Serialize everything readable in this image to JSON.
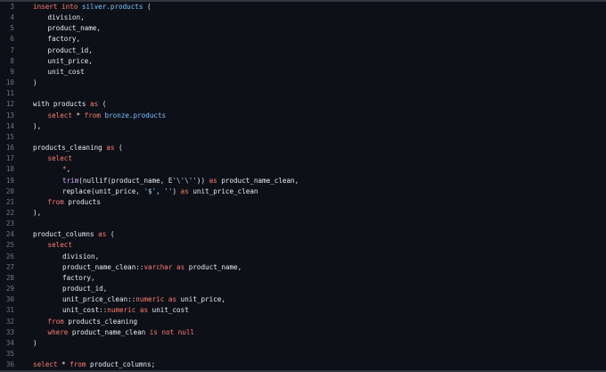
{
  "colors": {
    "background": "#0d1117",
    "line_number": "#6e7681",
    "plain": "#e6edf3",
    "keyword": "#ff7b72",
    "identifier": "#79c0ff",
    "function": "#d2a8ff",
    "string": "#a5d6ff"
  },
  "lines": [
    {
      "n": "3",
      "indent": 0,
      "tokens": [
        {
          "t": "insert into ",
          "c": "kw"
        },
        {
          "t": "silver.products",
          "c": "id"
        },
        {
          "t": " (",
          "c": "pl"
        }
      ]
    },
    {
      "n": "4",
      "indent": 1,
      "tokens": [
        {
          "t": "division,",
          "c": "pl"
        }
      ]
    },
    {
      "n": "5",
      "indent": 1,
      "tokens": [
        {
          "t": "product_name,",
          "c": "pl"
        }
      ]
    },
    {
      "n": "6",
      "indent": 1,
      "tokens": [
        {
          "t": "factory,",
          "c": "pl"
        }
      ]
    },
    {
      "n": "7",
      "indent": 1,
      "tokens": [
        {
          "t": "product_id,",
          "c": "pl"
        }
      ]
    },
    {
      "n": "8",
      "indent": 1,
      "tokens": [
        {
          "t": "unit_price,",
          "c": "pl"
        }
      ]
    },
    {
      "n": "9",
      "indent": 1,
      "tokens": [
        {
          "t": "unit_cost",
          "c": "pl"
        }
      ]
    },
    {
      "n": "10",
      "indent": 0,
      "tokens": [
        {
          "t": ")",
          "c": "pl"
        }
      ]
    },
    {
      "n": "11",
      "indent": 0,
      "tokens": []
    },
    {
      "n": "12",
      "indent": 0,
      "tokens": [
        {
          "t": "with products ",
          "c": "pl"
        },
        {
          "t": "as",
          "c": "kw"
        },
        {
          "t": " (",
          "c": "pl"
        }
      ]
    },
    {
      "n": "13",
      "indent": 1,
      "tokens": [
        {
          "t": "select",
          "c": "kw"
        },
        {
          "t": " * ",
          "c": "pl"
        },
        {
          "t": "from",
          "c": "kw"
        },
        {
          "t": " ",
          "c": "pl"
        },
        {
          "t": "bronze.products",
          "c": "id"
        }
      ]
    },
    {
      "n": "14",
      "indent": 0,
      "tokens": [
        {
          "t": "),",
          "c": "pl"
        }
      ]
    },
    {
      "n": "15",
      "indent": 0,
      "tokens": []
    },
    {
      "n": "16",
      "indent": 0,
      "tokens": [
        {
          "t": "products_cleaning ",
          "c": "pl"
        },
        {
          "t": "as",
          "c": "kw"
        },
        {
          "t": " (",
          "c": "pl"
        }
      ]
    },
    {
      "n": "17",
      "indent": 1,
      "tokens": [
        {
          "t": "select",
          "c": "kw"
        }
      ]
    },
    {
      "n": "18",
      "indent": 2,
      "tokens": [
        {
          "t": "*",
          "c": "kw"
        },
        {
          "t": ",",
          "c": "pl"
        }
      ]
    },
    {
      "n": "19",
      "indent": 2,
      "tokens": [
        {
          "t": "trim",
          "c": "fn"
        },
        {
          "t": "(nullif(product_name, E",
          "c": "pl"
        },
        {
          "t": "'\\'\\''",
          "c": "str"
        },
        {
          "t": ")) ",
          "c": "pl"
        },
        {
          "t": "as",
          "c": "kw"
        },
        {
          "t": " product_name_clean,",
          "c": "pl"
        }
      ]
    },
    {
      "n": "20",
      "indent": 2,
      "tokens": [
        {
          "t": "replace(unit_price, ",
          "c": "pl"
        },
        {
          "t": "'$'",
          "c": "str"
        },
        {
          "t": ", ",
          "c": "pl"
        },
        {
          "t": "''",
          "c": "str"
        },
        {
          "t": ") ",
          "c": "pl"
        },
        {
          "t": "as",
          "c": "kw"
        },
        {
          "t": " unit_price_clean",
          "c": "pl"
        }
      ]
    },
    {
      "n": "21",
      "indent": 1,
      "tokens": [
        {
          "t": "from",
          "c": "kw"
        },
        {
          "t": " products",
          "c": "pl"
        }
      ]
    },
    {
      "n": "22",
      "indent": 0,
      "tokens": [
        {
          "t": "),",
          "c": "pl"
        }
      ]
    },
    {
      "n": "23",
      "indent": 0,
      "tokens": []
    },
    {
      "n": "24",
      "indent": 0,
      "tokens": [
        {
          "t": "product_columns ",
          "c": "pl"
        },
        {
          "t": "as",
          "c": "kw"
        },
        {
          "t": " (",
          "c": "pl"
        }
      ]
    },
    {
      "n": "25",
      "indent": 1,
      "tokens": [
        {
          "t": "select",
          "c": "kw"
        }
      ]
    },
    {
      "n": "26",
      "indent": 2,
      "tokens": [
        {
          "t": "division,",
          "c": "pl"
        }
      ]
    },
    {
      "n": "27",
      "indent": 2,
      "tokens": [
        {
          "t": "product_name_clean::",
          "c": "pl"
        },
        {
          "t": "varchar",
          "c": "kw"
        },
        {
          "t": " ",
          "c": "pl"
        },
        {
          "t": "as",
          "c": "kw"
        },
        {
          "t": " product_name,",
          "c": "pl"
        }
      ]
    },
    {
      "n": "28",
      "indent": 2,
      "tokens": [
        {
          "t": "factory,",
          "c": "pl"
        }
      ]
    },
    {
      "n": "29",
      "indent": 2,
      "tokens": [
        {
          "t": "product_id,",
          "c": "pl"
        }
      ]
    },
    {
      "n": "30",
      "indent": 2,
      "tokens": [
        {
          "t": "unit_price_clean::",
          "c": "pl"
        },
        {
          "t": "numeric",
          "c": "kw"
        },
        {
          "t": " ",
          "c": "pl"
        },
        {
          "t": "as",
          "c": "kw"
        },
        {
          "t": " unit_price,",
          "c": "pl"
        }
      ]
    },
    {
      "n": "31",
      "indent": 2,
      "tokens": [
        {
          "t": "unit_cost::",
          "c": "pl"
        },
        {
          "t": "numeric",
          "c": "kw"
        },
        {
          "t": " ",
          "c": "pl"
        },
        {
          "t": "as",
          "c": "kw"
        },
        {
          "t": " unit_cost",
          "c": "pl"
        }
      ]
    },
    {
      "n": "32",
      "indent": 1,
      "tokens": [
        {
          "t": "from",
          "c": "kw"
        },
        {
          "t": " products_cleaning",
          "c": "pl"
        }
      ]
    },
    {
      "n": "33",
      "indent": 1,
      "tokens": [
        {
          "t": "where",
          "c": "kw"
        },
        {
          "t": " product_name_clean ",
          "c": "pl"
        },
        {
          "t": "is not null",
          "c": "kw"
        }
      ]
    },
    {
      "n": "34",
      "indent": 0,
      "tokens": [
        {
          "t": ")",
          "c": "pl"
        }
      ]
    },
    {
      "n": "35",
      "indent": 0,
      "tokens": []
    },
    {
      "n": "36",
      "indent": 0,
      "tokens": [
        {
          "t": "select",
          "c": "kw"
        },
        {
          "t": " * ",
          "c": "pl"
        },
        {
          "t": "from",
          "c": "kw"
        },
        {
          "t": " product_columns;",
          "c": "pl"
        }
      ]
    }
  ]
}
